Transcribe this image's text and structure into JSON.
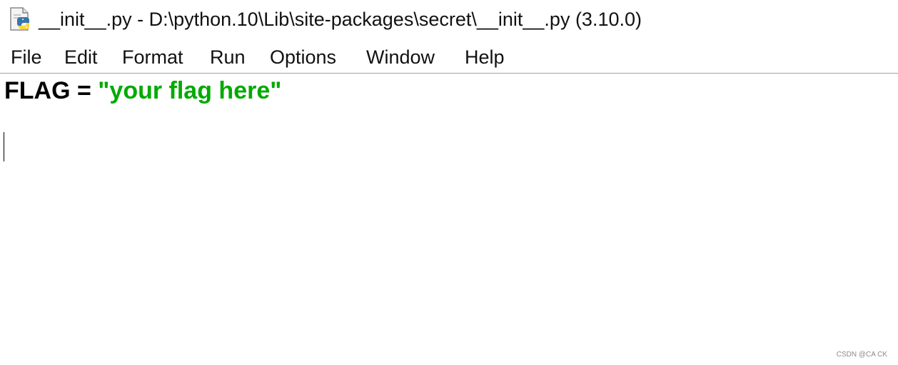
{
  "window": {
    "title": "__init__.py - D:\\python.10\\Lib\\site-packages\\secret\\__init__.py (3.10.0)",
    "icon": "python-file-icon"
  },
  "menu": {
    "items": [
      {
        "label": "File"
      },
      {
        "label": "Edit"
      },
      {
        "label": "Format"
      },
      {
        "label": "Run"
      },
      {
        "label": "Options"
      },
      {
        "label": "Window"
      },
      {
        "label": "Help"
      }
    ]
  },
  "editor": {
    "lines": [
      {
        "tokens": [
          {
            "text": "FLAG = ",
            "kind": "plain"
          },
          {
            "text": "\"your flag here\"",
            "kind": "string"
          }
        ]
      },
      {
        "tokens": []
      }
    ],
    "colors": {
      "plain": "#000000",
      "string": "#00aa00"
    }
  },
  "watermark": "CSDN @CA CK"
}
